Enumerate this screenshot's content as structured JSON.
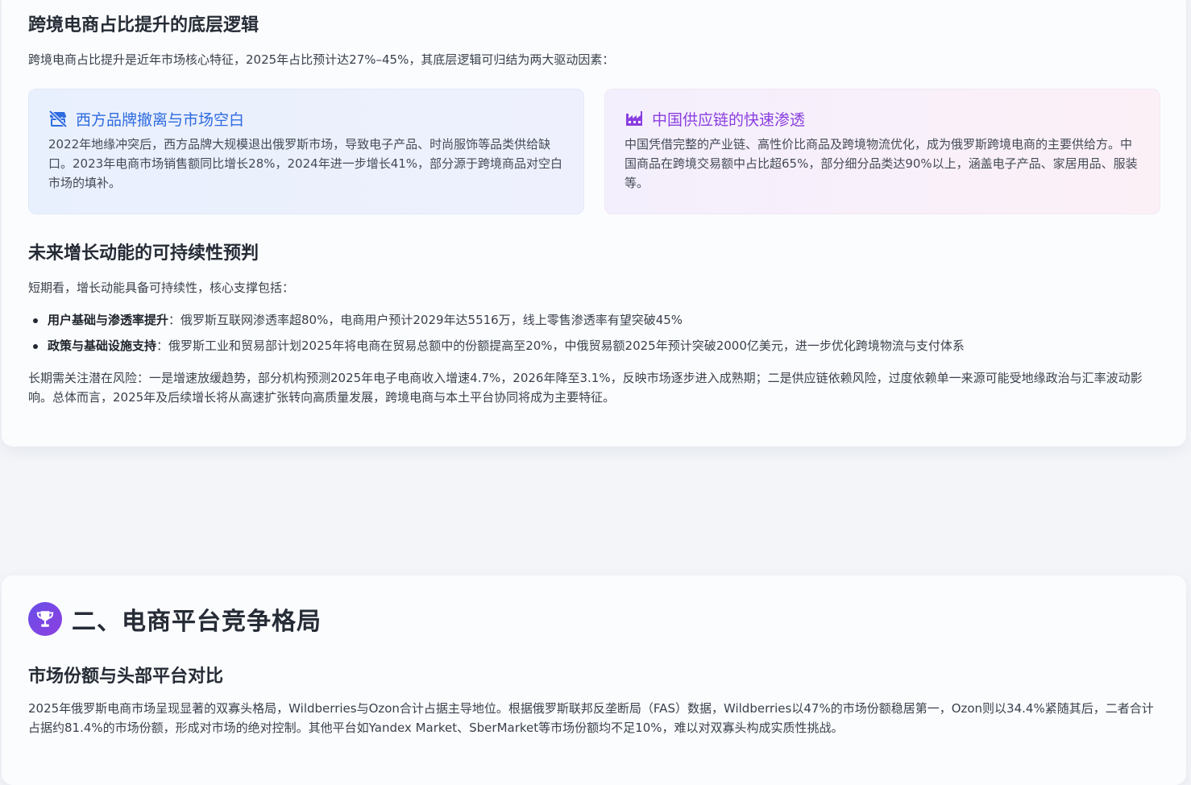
{
  "section1": {
    "heading_logic": "跨境电商占比提升的底层逻辑",
    "intro": "跨境电商占比提升是近年市场核心特征，2025年占比预计达27%–45%，其底层逻辑可归结为两大驱动因素：",
    "card_west": {
      "title": "西方品牌撤离与市场空白",
      "icon": "store-slash-icon",
      "text": "2022年地缘冲突后，西方品牌大规模退出俄罗斯市场，导致电子产品、时尚服饰等品类供给缺口。2023年电商市场销售额同比增长28%，2024年进一步增长41%，部分源于跨境商品对空白市场的填补。",
      "color": "#2e6be0"
    },
    "card_china": {
      "title": "中国供应链的快速渗透",
      "icon": "factory-icon",
      "text": "中国凭借完整的产业链、高性价比商品及跨境物流优化，成为俄罗斯跨境电商的主要供给方。中国商品在跨境交易额中占比超65%，部分细分品类达90%以上，涵盖电子产品、家居用品、服装等。",
      "color": "#8a3ee0"
    },
    "heading_future": "未来增长动能的可持续性预判",
    "short_term": "短期看，增长动能具备可持续性，核心支撑包括：",
    "bullets": [
      {
        "label": "用户基础与渗透率提升",
        "text": "：俄罗斯互联网渗透率超80%，电商用户预计2029年达5516万，线上零售渗透率有望突破45%"
      },
      {
        "label": "政策与基础设施支持",
        "text": "：俄罗斯工业和贸易部计划2025年将电商在贸易总额中的份额提高至20%，中俄贸易额2025年预计突破2000亿美元，进一步优化跨境物流与支付体系"
      }
    ],
    "long_term": "长期需关注潜在风险：一是增速放缓趋势，部分机构预测2025年电子电商收入增速4.7%，2026年降至3.1%，反映市场逐步进入成熟期；二是供应链依赖风险，过度依赖单一来源可能受地缘政治与汇率波动影响。总体而言，2025年及后续增长将从高速扩张转向高质量发展，跨境电商与本土平台协同将成为主要特征。"
  },
  "section2": {
    "icon": "trophy-icon",
    "title": "二、电商平台竞争格局",
    "heading_share": "市场份额与头部平台对比",
    "paragraph": "2025年俄罗斯电商市场呈现显著的双寡头格局，Wildberries与Ozon合计占据主导地位。根据俄罗斯联邦反垄断局（FAS）数据，Wildberries以47%的市场份额稳居第一，Ozon则以34.4%紧随其后，二者合计占据约81.4%的市场份额，形成对市场的绝对控制。其他平台如Yandex Market、SberMarket等市场份额均不足10%，难以对双寡头构成实质性挑战。"
  }
}
